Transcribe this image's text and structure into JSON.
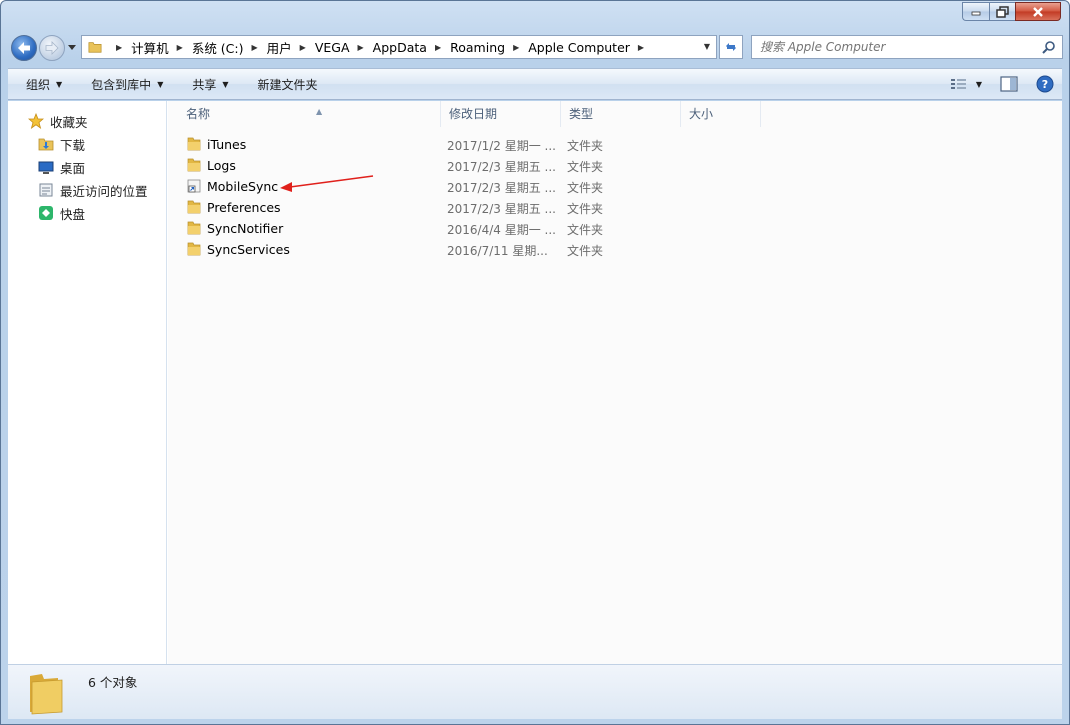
{
  "address": {
    "crumbs": [
      "计算机",
      "系统 (C:)",
      "用户",
      "VEGA",
      "AppData",
      "Roaming",
      "Apple Computer"
    ]
  },
  "search": {
    "placeholder": "搜索 Apple Computer"
  },
  "toolbar": {
    "organize": "组织",
    "include_library": "包含到库中",
    "share": "共享",
    "new_folder": "新建文件夹"
  },
  "nav": {
    "favorites": "收藏夹",
    "items": [
      {
        "label": "下载",
        "icon": "download-folder-icon"
      },
      {
        "label": "桌面",
        "icon": "desktop-icon"
      },
      {
        "label": "最近访问的位置",
        "icon": "recent-places-icon"
      },
      {
        "label": "快盘",
        "icon": "kuaipan-icon"
      }
    ]
  },
  "columns": {
    "name": "名称",
    "date": "修改日期",
    "type": "类型",
    "size": "大小"
  },
  "files": [
    {
      "name": "iTunes",
      "date": "2017/1/2 星期一 ...",
      "type": "文件夹",
      "icon": "folder-icon"
    },
    {
      "name": "Logs",
      "date": "2017/2/3 星期五 ...",
      "type": "文件夹",
      "icon": "folder-icon"
    },
    {
      "name": "MobileSync",
      "date": "2017/2/3 星期五 ...",
      "type": "文件夹",
      "icon": "folder-shortcut-icon"
    },
    {
      "name": "Preferences",
      "date": "2017/2/3 星期五 ...",
      "type": "文件夹",
      "icon": "folder-icon"
    },
    {
      "name": "SyncNotifier",
      "date": "2016/4/4 星期一 ...",
      "type": "文件夹",
      "icon": "folder-icon"
    },
    {
      "name": "SyncServices",
      "date": "2016/7/11 星期...",
      "type": "文件夹",
      "icon": "folder-icon"
    }
  ],
  "status": {
    "count": "6 个对象"
  },
  "colors": {
    "annotation_arrow": "#e0201b",
    "window_frame": "#bcd3eb"
  }
}
